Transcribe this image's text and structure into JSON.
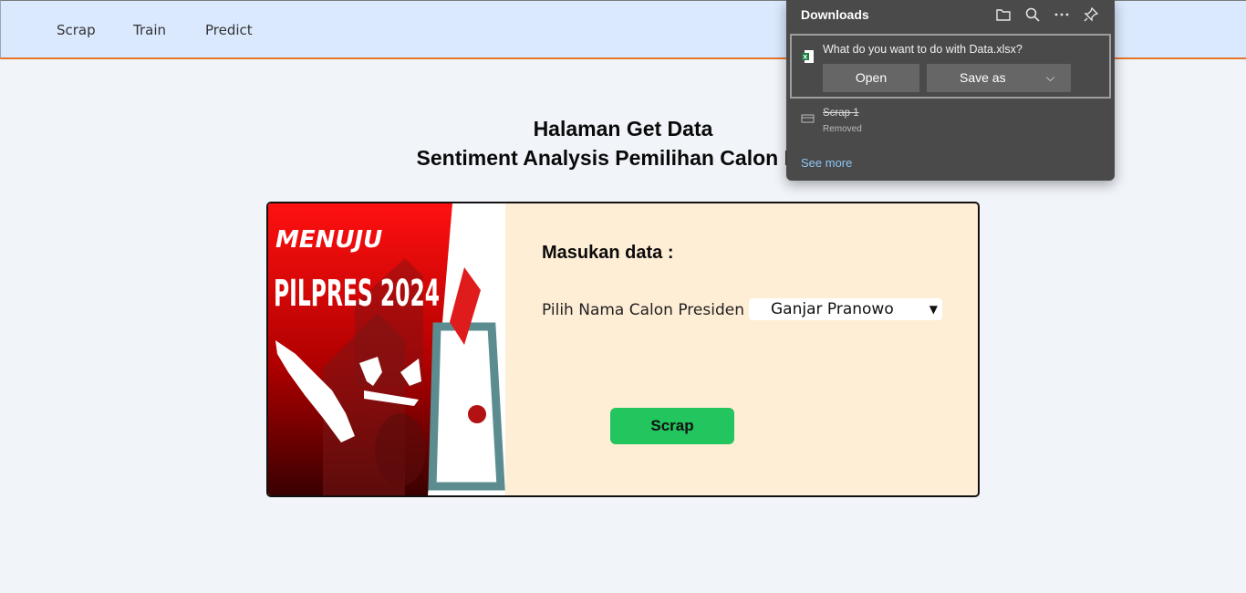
{
  "nav": {
    "items": [
      "Scrap",
      "Train",
      "Predict"
    ]
  },
  "heading": {
    "line1": "Halaman Get Data",
    "line2": "Sentiment Analysis Pemilihan Calon Pres"
  },
  "poster": {
    "text_top": "MENUJU",
    "text_main": "PILPRES 2024"
  },
  "form": {
    "title": "Masukan data :",
    "label": "Pilih Nama Calon Presiden",
    "select_value": "Ganjar Pranowo",
    "button_label": "Scrap"
  },
  "downloads": {
    "title": "Downloads",
    "question": "What do you want to do with Data.xlsx?",
    "open_label": "Open",
    "saveas_label": "Save as",
    "item_name": "Scrap 1",
    "item_status": "Removed",
    "see_more": "See more"
  },
  "colors": {
    "nav_bg": "#dbe9fe",
    "nav_accent": "#e8742a",
    "card_bg": "#ffeed6",
    "button": "#22c55e",
    "panel_bg": "#4a4a4a",
    "link": "#8cc6f5"
  }
}
